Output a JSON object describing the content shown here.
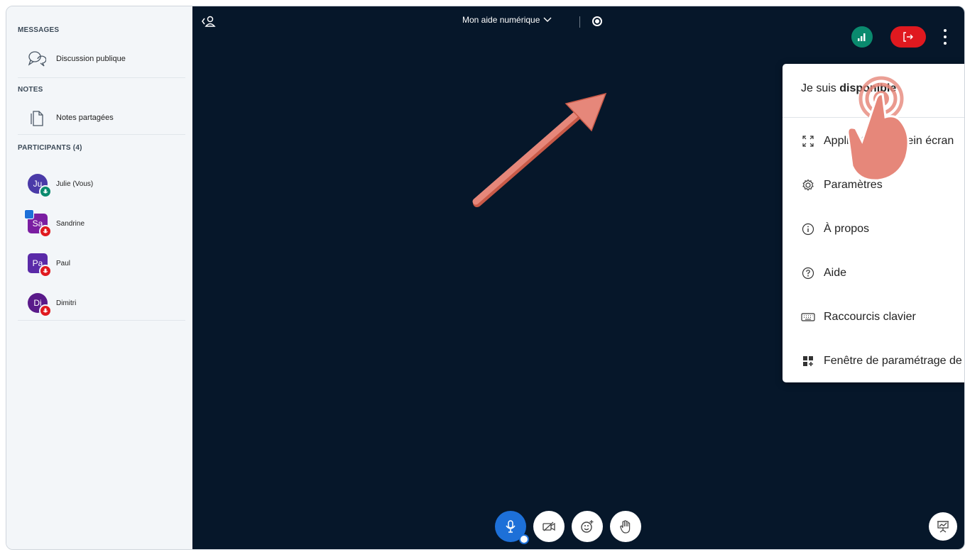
{
  "sidebar": {
    "messages_header": "MESSAGES",
    "public_chat": "Discussion publique",
    "notes_header": "NOTES",
    "shared_notes": "Notes partagées",
    "participants_header": "PARTICIPANTS (4)",
    "participants": [
      {
        "initials": "Ju",
        "name": "Julie (Vous)",
        "color": "#4a3aa8",
        "shape": "round",
        "status": "mic-on"
      },
      {
        "initials": "Sa",
        "name": "Sandrine",
        "color": "#7b1ea2",
        "shape": "square",
        "status": "muted",
        "presenter": true
      },
      {
        "initials": "Pa",
        "name": "Paul",
        "color": "#5a2aa8",
        "shape": "square",
        "status": "muted"
      },
      {
        "initials": "Di",
        "name": "Dimitri",
        "color": "#5a1a8a",
        "shape": "round",
        "status": "muted"
      }
    ]
  },
  "topbar": {
    "meeting_title": "Mon aide numérique",
    "connection_color": "#0a8a6e",
    "leave_color": "#e0191f"
  },
  "menu": {
    "status_prefix": "Je suis ",
    "status_value": "disponible",
    "status_toggle_on": true,
    "items": [
      {
        "label": "Application en plein écran",
        "icon": "fullscreen-icon"
      },
      {
        "label": "Paramètres",
        "icon": "gear-icon"
      },
      {
        "label": "À propos",
        "icon": "info-icon"
      },
      {
        "label": "Aide",
        "icon": "help-icon",
        "external": true
      },
      {
        "label": "Raccourcis clavier",
        "icon": "keyboard-icon"
      },
      {
        "label": "Fenêtre de paramétrage de la mise en page",
        "icon": "layout-icon"
      }
    ]
  },
  "controls": [
    "microphone-icon",
    "camera-off-icon",
    "reactions-icon",
    "raise-hand-icon",
    "presentation-icon"
  ],
  "colors": {
    "accent": "#1d70d8",
    "annotation": "#e27d70",
    "toggle": "#0f7a6a"
  }
}
